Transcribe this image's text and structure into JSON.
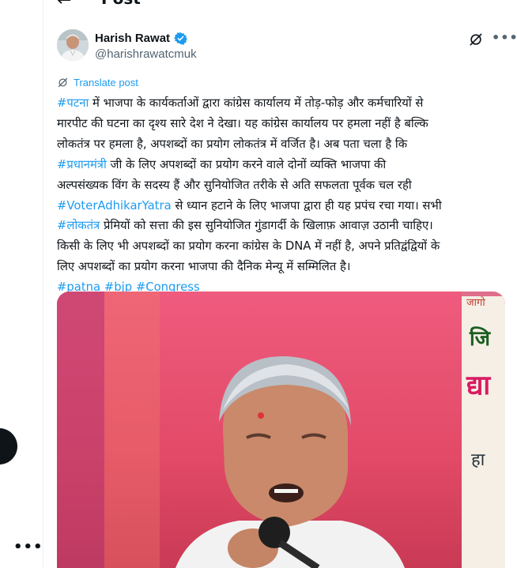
{
  "header": {
    "title": "Post"
  },
  "author": {
    "name": "Harish Rawat",
    "handle": "@harishrawatcmuk"
  },
  "translate_label": "Translate post",
  "post": {
    "l1": {
      "tag": "#पटना",
      "text": " में भाजपा के कार्यकर्ताओं द्वारा कांग्रेस कार्यालय में तोड़-फोड़ और कर्मचारियों से"
    },
    "l2": "मारपीट की घटना का दृश्य सारे देश ने देखा। यह कांग्रेस कार्यालय पर हमला नहीं है बल्कि",
    "l3": "लोकतंत्र पर हमला है, अपशब्दों का प्रयोग लोकतंत्र में वर्जित है। अब पता चला है कि",
    "l4": {
      "tag": "#प्रधानमंत्री",
      "text": " जी के लिए अपशब्दों का प्रयोग करने वाले दोनों व्यक्ति भाजपा की"
    },
    "l5": "अल्पसंख्यक विंग के सदस्य हैं और सुनियोजित तरीके से अति सफलता पूर्वक चल रही",
    "l6": {
      "tag": "#VoterAdhikarYatra",
      "text": " से ध्यान हटाने के लिए भाजपा द्वारा ही यह प्रपंच रचा गया। सभी"
    },
    "l7": {
      "tag": "#लोकतंत्र",
      "text": " प्रेमियों को सत्ता की इस सुनियोजित गुंडागर्दी के खिलाफ़ आवाज़ उठानी चाहिए।"
    },
    "l8": "किसी के लिए भी अपशब्दों का प्रयोग करना कांग्रेस के DNA में नहीं है, अपने प्रतिद्वंद्वियों के",
    "l9": "लिए अपशब्दों का प्रयोग करना भाजपा की दैनिक मेन्यू में सम्मिलित है।",
    "hashtags": [
      "#patna",
      "#bjp",
      "#Congress"
    ]
  },
  "media": {
    "banner_lines": [
      "जागो",
      "जि",
      "द्या",
      "हा"
    ]
  },
  "icons": {
    "back": "back-arrow-icon",
    "verified": "verified-badge-icon",
    "grok": "grok-icon",
    "more": "more-icon",
    "translate": "translate-icon"
  },
  "colors": {
    "link": "#1d9bf0",
    "text": "#0f1419",
    "muted": "#536471",
    "verified": "#1d9bf0"
  }
}
